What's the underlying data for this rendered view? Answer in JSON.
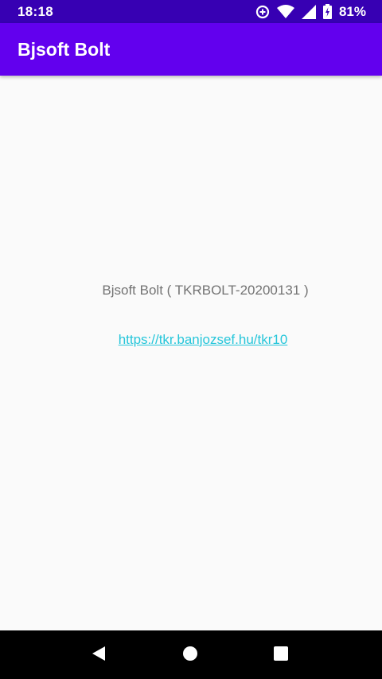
{
  "status_bar": {
    "time": "18:18",
    "battery": "81%",
    "icons": [
      "data-saver-icon",
      "wifi-icon",
      "cell-signal-icon",
      "battery-icon"
    ]
  },
  "app_bar": {
    "title": "Bjsoft Bolt"
  },
  "main": {
    "version_text": "Bjsoft Bolt ( TKRBOLT-20200131 )",
    "link_text": "https://tkr.banjozsef.hu/tkr10"
  },
  "nav_bar": {
    "buttons": [
      "back-icon",
      "home-icon",
      "recents-icon"
    ]
  },
  "colors": {
    "status_bar": "#3700b3",
    "app_bar": "#6200ee",
    "background": "#fafafa",
    "link": "#26c6da",
    "text": "#737373"
  }
}
